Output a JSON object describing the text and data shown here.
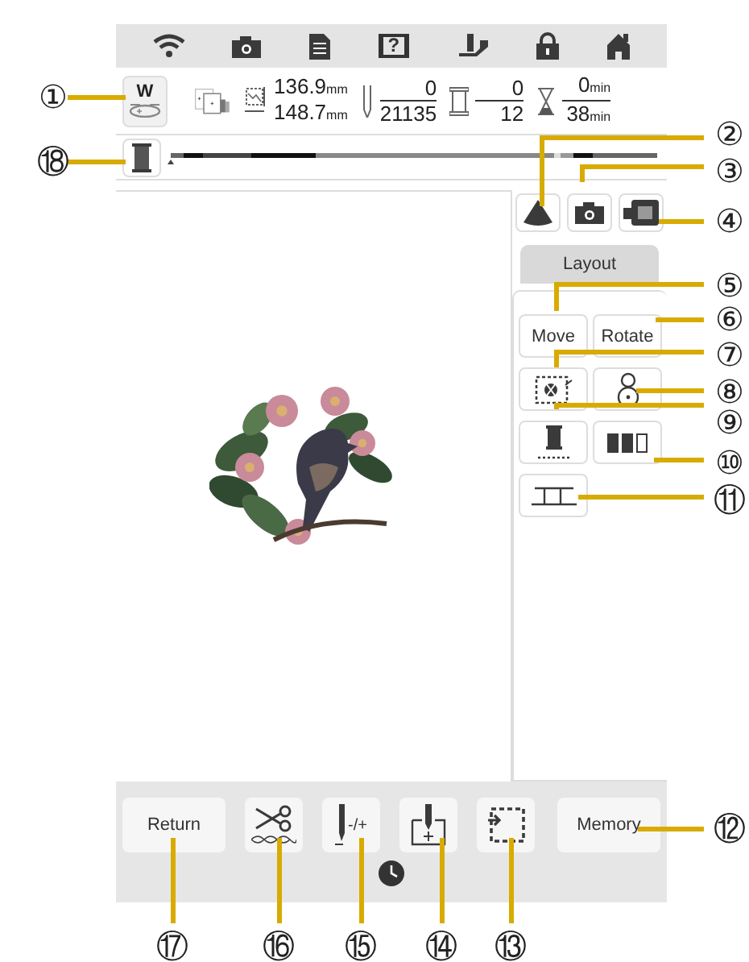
{
  "status_icons": [
    {
      "kind": "wifi"
    },
    {
      "kind": "camera"
    },
    {
      "kind": "document"
    },
    {
      "kind": "help",
      "label": "?"
    },
    {
      "kind": "presser-foot"
    },
    {
      "kind": "lock"
    },
    {
      "kind": "home"
    }
  ],
  "info": {
    "design_button": {
      "label": "W"
    },
    "size": [
      {
        "value": "136.9",
        "unit": "mm"
      },
      {
        "value": "148.7",
        "unit": "mm"
      }
    ],
    "stitches": {
      "current": "0",
      "total": "21135"
    },
    "colors": {
      "current": "0",
      "total": "12"
    },
    "time": {
      "current": "0",
      "current_unit": "min",
      "total": "38",
      "total_unit": "min"
    }
  },
  "panel": {
    "top_buttons": [
      {
        "kind": "triangle"
      },
      {
        "kind": "camera"
      },
      {
        "kind": "film"
      }
    ],
    "tab": {
      "label": "Layout",
      "selected": true
    },
    "buttons": [
      {
        "kind": "text",
        "label": "Move"
      },
      {
        "kind": "text",
        "label": "Rotate"
      },
      {
        "kind": "frame-move"
      },
      {
        "kind": "center"
      },
      {
        "kind": "spool"
      },
      {
        "kind": "spools"
      },
      {
        "kind": "baseline"
      }
    ]
  },
  "bottom_buttons": [
    {
      "kind": "text",
      "label": "Return"
    },
    {
      "kind": "scissors"
    },
    {
      "kind": "needle",
      "label": "-/+"
    },
    {
      "kind": "start-point"
    },
    {
      "kind": "trial"
    },
    {
      "kind": "text",
      "label": "Memory"
    }
  ],
  "callouts": [
    {
      "label": "①"
    },
    {
      "label": "②"
    },
    {
      "label": "⑱"
    },
    {
      "label": "③"
    },
    {
      "label": "④"
    },
    {
      "label": "⑤"
    },
    {
      "label": "⑥"
    },
    {
      "label": "⑦"
    },
    {
      "label": "⑧"
    },
    {
      "label": "⑨"
    },
    {
      "label": "⑩"
    },
    {
      "label": "⑪"
    },
    {
      "label": "⑫"
    },
    {
      "label": "⑰"
    },
    {
      "label": "⑯"
    },
    {
      "label": "⑮"
    },
    {
      "label": "⑭"
    },
    {
      "label": "⑬"
    }
  ]
}
